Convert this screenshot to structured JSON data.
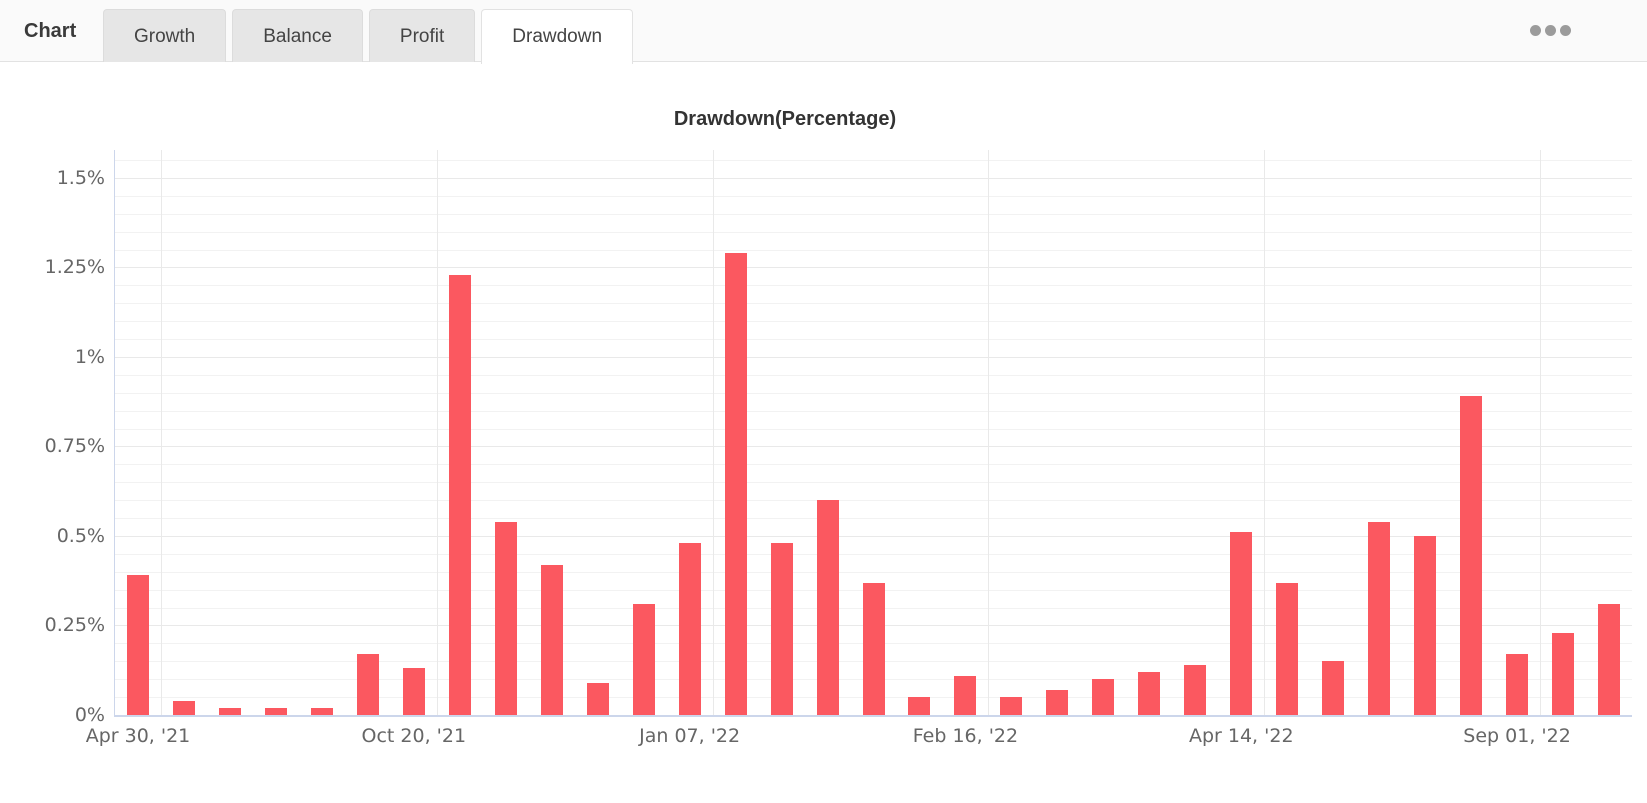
{
  "header": {
    "title": "Chart",
    "tabs": [
      {
        "label": "Growth",
        "active": false
      },
      {
        "label": "Balance",
        "active": false
      },
      {
        "label": "Profit",
        "active": false
      },
      {
        "label": "Drawdown",
        "active": true
      }
    ],
    "menu_icon": "ellipsis-icon"
  },
  "chart_data": {
    "type": "bar",
    "title": "Drawdown(Percentage)",
    "series_name": "Drawdown",
    "unit": "%",
    "values": [
      0.39,
      0.04,
      0.02,
      0.02,
      0.02,
      0.17,
      0.13,
      1.23,
      0.54,
      0.42,
      0.09,
      0.31,
      0.48,
      1.29,
      0.48,
      0.6,
      0.37,
      0.05,
      0.11,
      0.05,
      0.07,
      0.1,
      0.12,
      0.14,
      0.51,
      0.37,
      0.15,
      0.54,
      0.5,
      0.89,
      0.17,
      0.23,
      0.31
    ],
    "x_ticks": [
      {
        "index": 0,
        "label": "Apr 30, '21"
      },
      {
        "index": 6,
        "label": "Oct 20, '21"
      },
      {
        "index": 12,
        "label": "Jan 07, '22"
      },
      {
        "index": 18,
        "label": "Feb 16, '22"
      },
      {
        "index": 24,
        "label": "Apr 14, '22"
      },
      {
        "index": 30,
        "label": "Sep 01, '22"
      }
    ],
    "y_ticks": [
      {
        "value": 0,
        "label": "0%"
      },
      {
        "value": 0.25,
        "label": "0.25%"
      },
      {
        "value": 0.5,
        "label": "0.5%"
      },
      {
        "value": 0.75,
        "label": "0.75%"
      },
      {
        "value": 1,
        "label": "1%"
      },
      {
        "value": 1.25,
        "label": "1.25%"
      },
      {
        "value": 1.5,
        "label": "1.5%"
      }
    ],
    "ylim": [
      0,
      1.578
    ],
    "minor_tick_step": 0.05,
    "major_tick_step": 0.25,
    "grid": true,
    "legend": "none",
    "bar_color": "#fb5860",
    "axis_line_color": "#ccd6eb"
  }
}
